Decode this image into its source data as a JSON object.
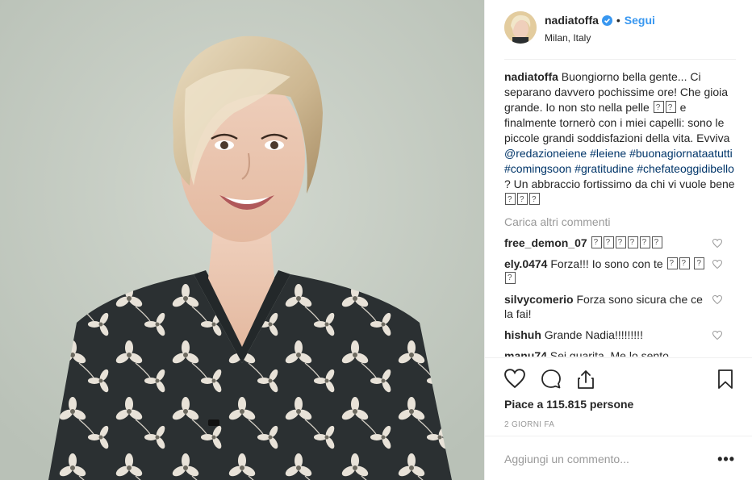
{
  "post": {
    "username": "nadiatoffa",
    "follow_label": "Segui",
    "separator": "•",
    "location": "Milan, Italy",
    "caption": {
      "username": "nadiatoffa",
      "text_1": " Buongiorno bella gente... Ci separano davvero pochissime ore! Che gioia grande. Io non sto nella pelle ",
      "text_2": " e finalmente tornerò con i miei capelli: sono le piccole grandi soddisfazioni della vita. Evviva ",
      "mention": "@redazioneiene",
      "tags": [
        "#leiene",
        "#buonagiornataatutti",
        "#comingsoon",
        "#gratitudine",
        "#chefateoggidibello"
      ],
      "text_3": " ? Un abbraccio fortissimo da chi vi vuole bene "
    },
    "load_more": "Carica altri commenti",
    "comments": [
      {
        "username": "free_demon_07",
        "text": " "
      },
      {
        "username": "ely.0474",
        "text": " Forza!!! Io sono con te "
      },
      {
        "username": "silvycomerio",
        "text": " Forza sono sicura che ce la fai!"
      },
      {
        "username": "hishuh",
        "text": " Grande Nadia!!!!!!!!!"
      },
      {
        "username": "manu74",
        "text": " Sei guarita. Me lo sento"
      }
    ],
    "likes": "Piace a 115.815 persone",
    "timestamp": "2 GIORNI FA",
    "comment_placeholder": "Aggiungi un commento...",
    "options": "•••"
  },
  "icons": {
    "verified": "verified-badge-icon",
    "like": "heart-icon",
    "comment": "comment-bubble-icon",
    "share": "share-icon",
    "save": "bookmark-icon"
  },
  "colors": {
    "link": "#3897f0",
    "hashtag": "#003569",
    "muted": "#999999",
    "text": "#262626",
    "border": "#efefef"
  }
}
